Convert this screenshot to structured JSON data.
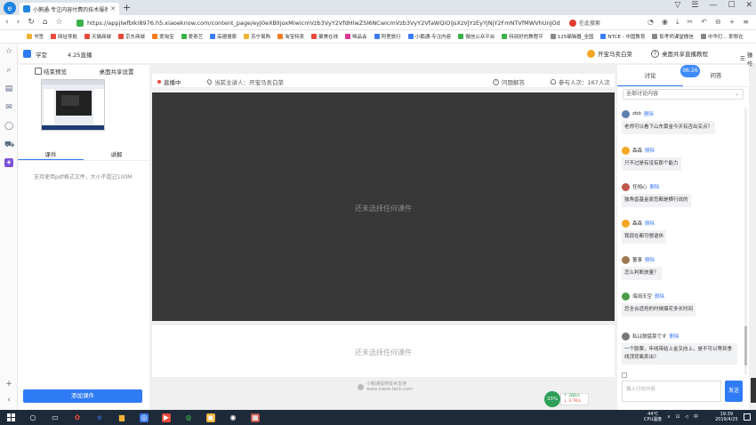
{
  "browser": {
    "tab_title": "小鹅通-专注内容付费的技术服务商",
    "url": "https://appjlwfbIki8976.h5.xiaoeknow.com/content_page/eyJ0eXBlIjoxMiwicmVzb3VyY2VfdHlwZSI6NCwicmVzb3VyY2VfaWQiOiJsXzVjYzEyYjNjY2FmNTVfMWVhUnJOd",
    "search_placeholder": "在此搜索",
    "bookmarks": [
      {
        "label": "书签",
        "color": "#f2b134"
      },
      {
        "label": "网址导航",
        "color": "#e8493b"
      },
      {
        "label": "天猫商城",
        "color": "#e8493b"
      },
      {
        "label": "京东商城",
        "color": "#e8493b"
      },
      {
        "label": "爱淘宝",
        "color": "#f57c20"
      },
      {
        "label": "爱奇艺",
        "color": "#3bb14a"
      },
      {
        "label": "高德搜索",
        "color": "#3d7bf5"
      },
      {
        "label": "苏宁易购",
        "color": "#f2b134"
      },
      {
        "label": "淘宝特卖",
        "color": "#f57c20"
      },
      {
        "label": "聚美在线",
        "color": "#e8493b"
      },
      {
        "label": "唯品会",
        "color": "#d63b8f"
      },
      {
        "label": "阿里旅行",
        "color": "#3d7bf5"
      },
      {
        "label": "小鹅通-专注内容",
        "color": "#3d7bf5"
      },
      {
        "label": "微信公众平台",
        "color": "#3bb14a"
      },
      {
        "label": "特别好的教程平",
        "color": "#3bb14a"
      },
      {
        "label": "125编辑器_全国",
        "color": "#888888"
      },
      {
        "label": "NTCE - 中国教育",
        "color": "#3d7bf5"
      },
      {
        "label": "影考师课堂微信",
        "color": "#888888"
      },
      {
        "label": "中华灯... 职称在",
        "color": "#888888"
      }
    ]
  },
  "header": {
    "school": "学堂",
    "live_name": "4.25直播",
    "cta": "开宝马卖白菜",
    "help": "桌面共享直播教程",
    "ops": "操作"
  },
  "left": {
    "tab_preview": "结束预览",
    "tab_share_settings": "桌面共享设置",
    "subtab_courseware": "课件",
    "subtab_explain": "讲解",
    "hint": "支持使用pdf格式文件，大小不超过100M",
    "add_button": "添加课件"
  },
  "center": {
    "live_status": "直播中",
    "speaker": "当前主讲人：开宝马卖白菜",
    "qa": "问题解答",
    "online": "参与人次：167人次",
    "empty_text": "还未选择任何课件",
    "empty_text_2": "还未选择任何课件",
    "powered": "小鹅通提供技术支持",
    "powered_sub": "www.xiaoe-tech.com",
    "perf_percent": "33%",
    "perf_up": "↑ 2BB/s",
    "perf_down": "↓ 3.7K/s"
  },
  "discussion": {
    "tab_discuss": "讨论",
    "tab_qa": "问答",
    "timer": "06:26",
    "filter": "全部讨论内容",
    "delete_label": "删除",
    "input_placeholder": "输入讨论内容",
    "send": "发送",
    "messages": [
      {
        "name": "zbb",
        "text": "老师可以看下山东黄金今天有否出买点？",
        "color": "#5c7fae"
      },
      {
        "name": "森森",
        "text": "只不过是有没有那个能力",
        "color": "#f5a623"
      },
      {
        "name": "任相心",
        "text": "独角兽基金原您都是横行说的",
        "color": "#c2554b"
      },
      {
        "name": "森森",
        "text": "我现在都可想退休",
        "color": "#f5a623"
      },
      {
        "name": "董事",
        "text": "怎么判断放量？",
        "color": "#a07850"
      },
      {
        "name": "海阔天空",
        "text": "您全合适坦的时候爆花多长时间",
        "color": "#4a9b4a"
      },
      {
        "name": "私は鼓猛豪です",
        "text": "一个股票，年线带给上金叉向上，是不可以等到季线顶背离卖出？",
        "color": "#777777"
      }
    ]
  },
  "taskbar": {
    "temp": "44℃",
    "temp_label": "CPU温度",
    "ime": "中",
    "time": "19:39",
    "date": "2019/4/25"
  }
}
